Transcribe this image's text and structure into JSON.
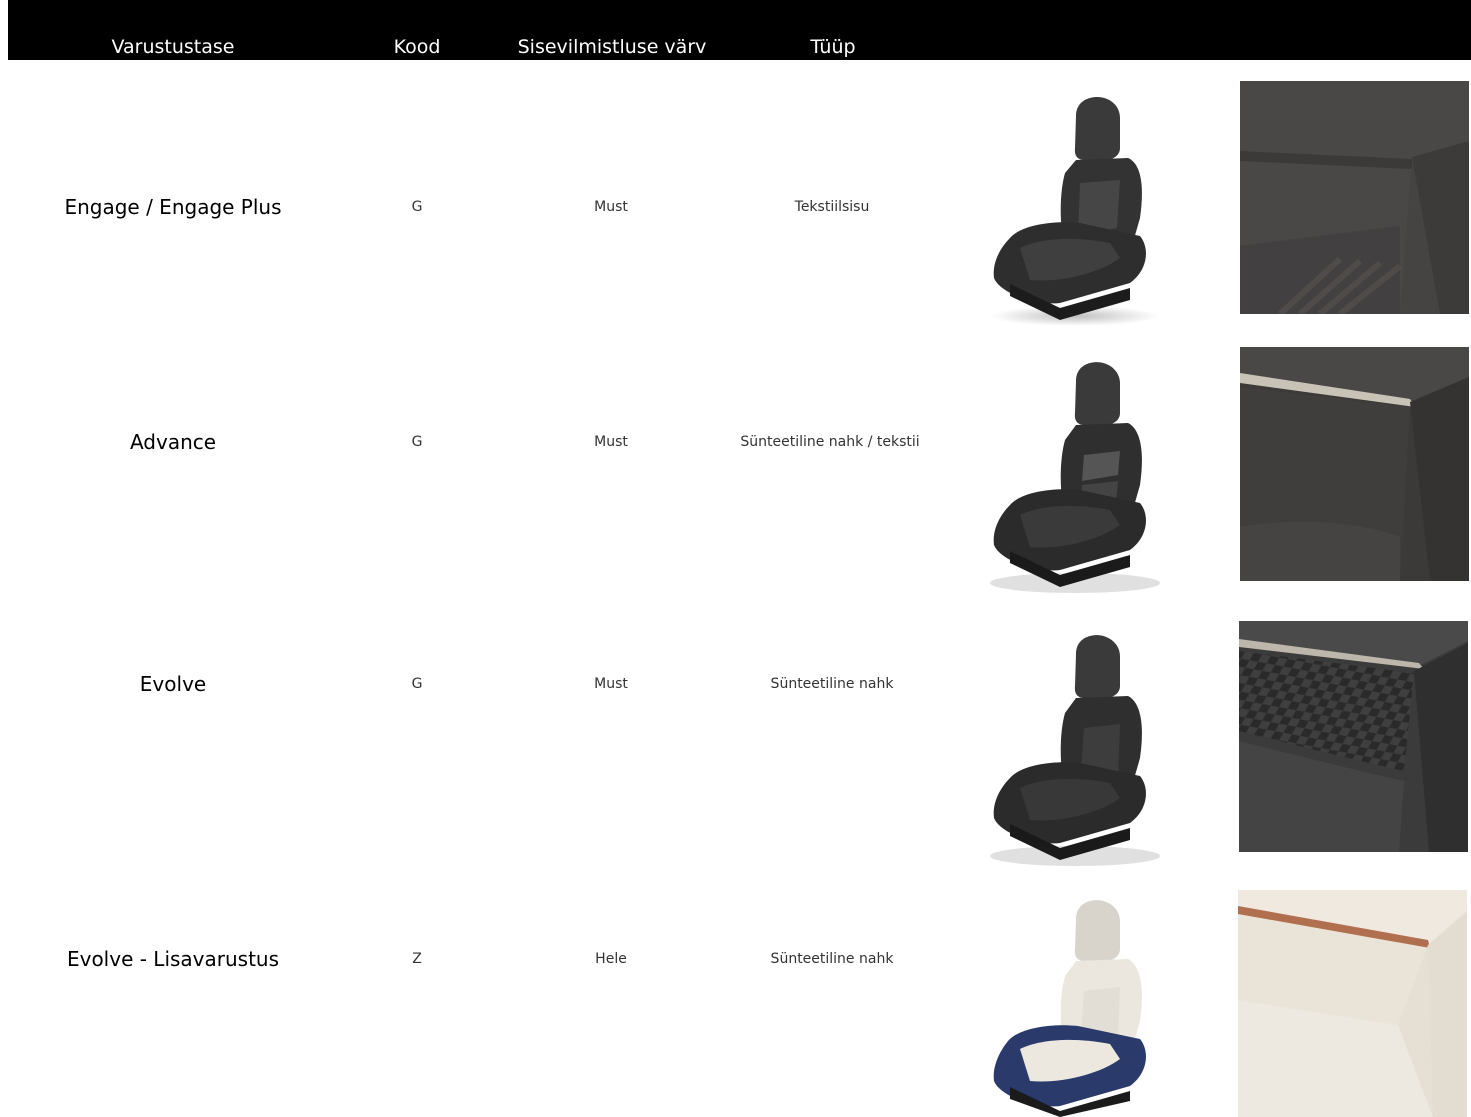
{
  "header": {
    "columns": [
      "Varustustase",
      "Kood",
      "Sisevilmistluse värv",
      "Tüüp"
    ]
  },
  "rows": [
    {
      "trim": "Engage / Engage Plus",
      "code": "G",
      "color": "Must",
      "type": "Tekstiilsisu",
      "seat_icon": "seat-icon",
      "swatch_icon": "fabric-swatch-icon"
    },
    {
      "trim": "Advance",
      "code": "G",
      "color": "Must",
      "type": "Sünteetiline nahk / tekstii",
      "seat_icon": "seat-icon",
      "swatch_icon": "leather-fabric-swatch-icon"
    },
    {
      "trim": "Evolve",
      "code": "G",
      "color": "Must",
      "type": "Sünteetiline nahk",
      "seat_icon": "seat-icon",
      "swatch_icon": "leather-swatch-icon"
    },
    {
      "trim": "Evolve - Lisavarustus",
      "code": "Z",
      "color": "Hele",
      "type": "Sünteetiline nahk",
      "seat_icon": "seat-icon",
      "swatch_icon": "light-leather-swatch-icon"
    }
  ]
}
